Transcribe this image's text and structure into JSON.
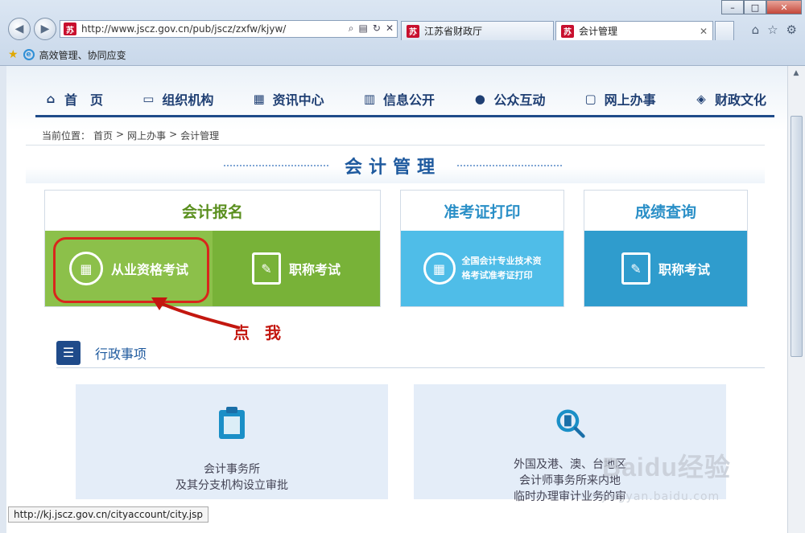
{
  "browser": {
    "address": "http://www.jscz.gov.cn/pub/jscz/zxfw/kjyw/",
    "favicon_text": "苏",
    "tabs": [
      {
        "label": "江苏省财政厅"
      },
      {
        "label": "会计管理"
      }
    ],
    "favorites_bar_item": "高效管理、协同应变",
    "status_url": "http://kj.jscz.gov.cn/cityaccount/city.jsp"
  },
  "nav": {
    "items": [
      {
        "label": "首　页",
        "icon": "home-icon"
      },
      {
        "label": "组织机构",
        "icon": "id-card-icon"
      },
      {
        "label": "资讯中心",
        "icon": "news-icon"
      },
      {
        "label": "信息公开",
        "icon": "columns-icon"
      },
      {
        "label": "公众互动",
        "icon": "user-icon"
      },
      {
        "label": "网上办事",
        "icon": "monitor-icon"
      },
      {
        "label": "财政文化",
        "icon": "culture-icon"
      }
    ]
  },
  "breadcrumb": {
    "prefix": "当前位置：",
    "items": [
      "首页",
      "网上办事",
      "会计管理"
    ],
    "separator": ">"
  },
  "section": {
    "title": "会计管理"
  },
  "cards": {
    "registration": {
      "title": "会计报名",
      "options": [
        {
          "label": "从业资格考试",
          "icon": "abacus-icon"
        },
        {
          "label": "职称考试",
          "icon": "edit-icon"
        }
      ]
    },
    "admission": {
      "title": "准考证打印",
      "line1": "全国会计专业技术资",
      "line2": "格考试准考证打印"
    },
    "scores": {
      "title": "成绩查询",
      "option": "职称考试"
    }
  },
  "annotation": {
    "text": "点 我",
    "color": "#c3170f"
  },
  "admin": {
    "title": "行政事项",
    "services": [
      {
        "line1": "会计事务所",
        "line2": "及其分支机构设立审批",
        "line3": ""
      },
      {
        "line1": "外国及港、澳、台地区",
        "line2": "会计师事务所来内地",
        "line3": "临时办理审计业务的审"
      }
    ]
  },
  "watermark": {
    "logo": "Baidu经验",
    "url": "jingyan.baidu.com"
  },
  "colors": {
    "nav_text": "#1f3f73",
    "registration_green": "#8cc04a",
    "registration_green_dark": "#78b238",
    "admission_blue": "#4fbde8",
    "scores_blue": "#2f9ccd",
    "registration_title": "#5a8f1e",
    "admission_title": "#2a8fc7",
    "callout_red": "#d9261c"
  }
}
